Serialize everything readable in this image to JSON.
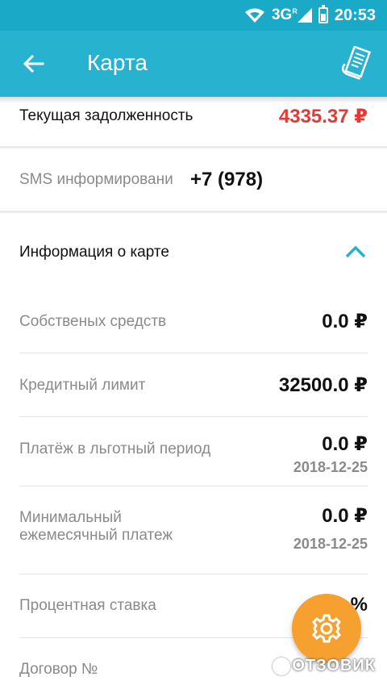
{
  "status_bar": {
    "network": "3G",
    "network_sup": "R",
    "time": "20:53"
  },
  "app_bar": {
    "title": "Карта"
  },
  "debt": {
    "label": "Текущая задолженность",
    "value": "4335.37 ₽",
    "value_color": "#e53935"
  },
  "sms": {
    "label": "SMS информировани",
    "value": "+7 (978)"
  },
  "card_info": {
    "title": "Информация о карте",
    "rows": [
      {
        "label": "Собственых средств",
        "value": "0.0 ₽"
      },
      {
        "label": "Кредитный лимит",
        "value": "32500.0 ₽"
      },
      {
        "label": "Платёж в льготный период",
        "value": "0.0 ₽",
        "date": "2018-12-25"
      },
      {
        "label_line1": "Минимальный",
        "label_line2": "ежемесячный платеж",
        "value": "0.0 ₽",
        "date": "2018-12-25"
      },
      {
        "label": "Процентная ставка",
        "value": "%"
      },
      {
        "label": "Договор №"
      }
    ]
  },
  "watermark": {
    "text": "ОТЗОВИК"
  },
  "colors": {
    "status_bar": "#1aa9c6",
    "app_bar": "#27b3cf",
    "accent": "#27b3cf",
    "fab": "#f5a02f"
  },
  "icons": {
    "back": "arrow-left-icon",
    "receipt": "receipt-icon",
    "collapse": "chevron-up-icon",
    "fab": "gear-icon"
  }
}
